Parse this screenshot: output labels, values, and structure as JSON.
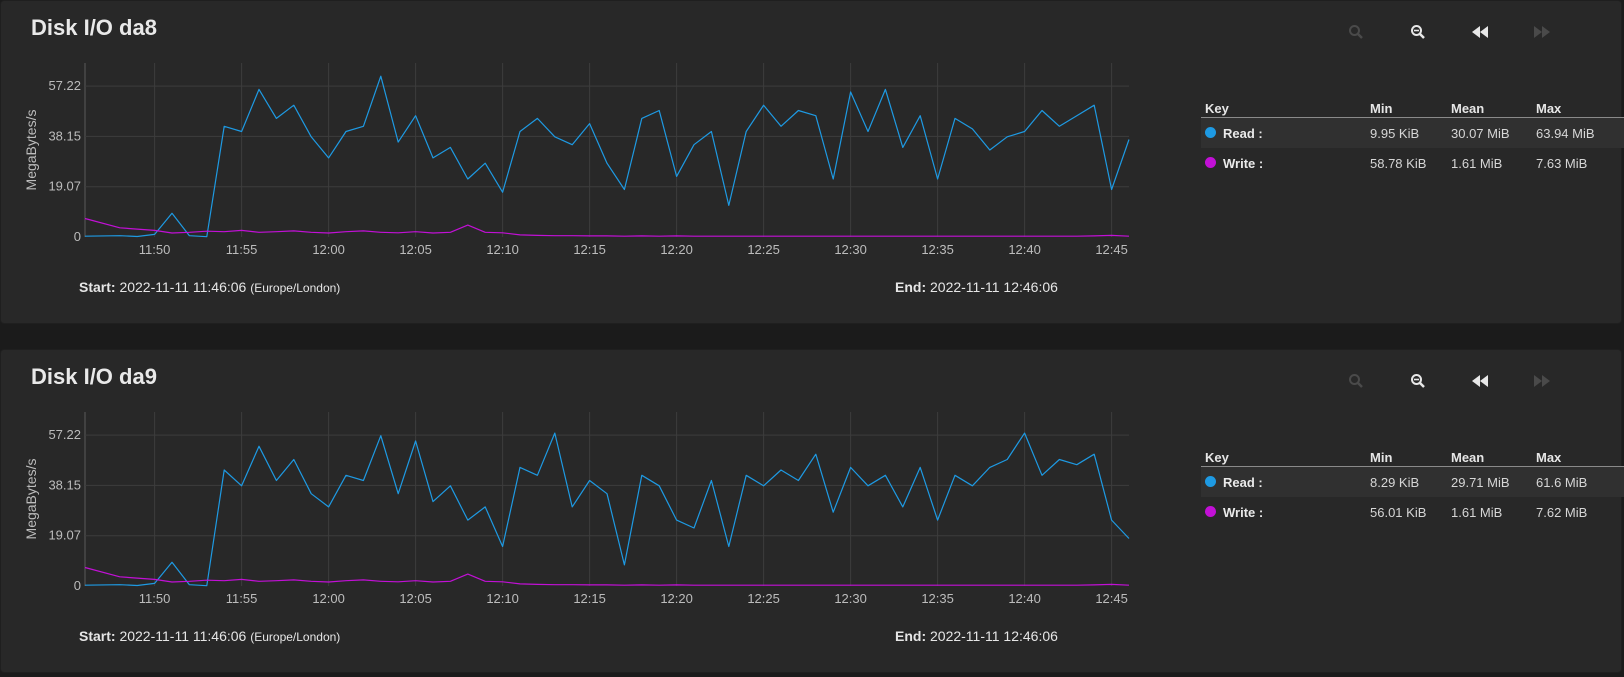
{
  "cards": [
    {
      "title": "Disk I/O da8",
      "start_label": "Start:",
      "start_value": "2022-11-11 11:46:06",
      "timezone": "(Europe/London)",
      "end_label": "End:",
      "end_value": "2022-11-11 12:46:06",
      "legend": {
        "header": {
          "key": "Key",
          "min": "Min",
          "mean": "Mean",
          "max": "Max"
        },
        "rows": [
          {
            "name": "Read :",
            "color": "#1e9ae3",
            "min": "9.95 KiB",
            "mean": "30.07 MiB",
            "max": "63.94 MiB"
          },
          {
            "name": "Write :",
            "color": "#c210d6",
            "min": "58.78 KiB",
            "mean": "1.61 MiB",
            "max": "7.63 MiB"
          }
        ]
      },
      "toolbar": {
        "zoom_in": "zoom-in-icon",
        "zoom_out": "zoom-out-icon",
        "back": "rewind-icon",
        "forward": "fast-forward-icon"
      }
    },
    {
      "title": "Disk I/O da9",
      "start_label": "Start:",
      "start_value": "2022-11-11 11:46:06",
      "timezone": "(Europe/London)",
      "end_label": "End:",
      "end_value": "2022-11-11 12:46:06",
      "legend": {
        "header": {
          "key": "Key",
          "min": "Min",
          "mean": "Mean",
          "max": "Max"
        },
        "rows": [
          {
            "name": "Read :",
            "color": "#1e9ae3",
            "min": "8.29 KiB",
            "mean": "29.71 MiB",
            "max": "61.6 MiB"
          },
          {
            "name": "Write :",
            "color": "#c210d6",
            "min": "56.01 KiB",
            "mean": "1.61 MiB",
            "max": "7.62 MiB"
          }
        ]
      },
      "toolbar": {
        "zoom_in": "zoom-in-icon",
        "zoom_out": "zoom-out-icon",
        "back": "rewind-icon",
        "forward": "fast-forward-icon"
      }
    }
  ],
  "chart_data": [
    {
      "type": "line",
      "ylabel": "MegaBytes/s",
      "yticks": [
        0,
        19.07,
        38.15,
        57.22
      ],
      "ylim": [
        0,
        66
      ],
      "xlim": [
        "11:46",
        "12:46"
      ],
      "xticks": [
        "11:50",
        "11:55",
        "12:00",
        "12:05",
        "12:10",
        "12:15",
        "12:20",
        "12:25",
        "12:30",
        "12:35",
        "12:40",
        "12:45"
      ],
      "grid": true,
      "series": [
        {
          "name": "Read",
          "color": "#1e9ae3",
          "x": [
            "11:46",
            "11:48",
            "11:49",
            "11:50",
            "11:51",
            "11:52",
            "11:53",
            "11:54",
            "11:55",
            "11:56",
            "11:57",
            "11:58",
            "11:59",
            "12:00",
            "12:01",
            "12:02",
            "12:03",
            "12:04",
            "12:05",
            "12:06",
            "12:07",
            "12:08",
            "12:09",
            "12:10",
            "12:11",
            "12:12",
            "12:13",
            "12:14",
            "12:15",
            "12:16",
            "12:17",
            "12:18",
            "12:19",
            "12:20",
            "12:21",
            "12:22",
            "12:23",
            "12:24",
            "12:25",
            "12:26",
            "12:27",
            "12:28",
            "12:29",
            "12:30",
            "12:31",
            "12:32",
            "12:33",
            "12:34",
            "12:35",
            "12:36",
            "12:37",
            "12:38",
            "12:39",
            "12:40",
            "12:41",
            "12:42",
            "12:43",
            "12:44",
            "12:45",
            "12:46"
          ],
          "y": [
            0.3,
            0.5,
            0.2,
            1,
            9,
            0.5,
            0.1,
            42,
            40,
            56,
            45,
            50,
            38,
            30,
            40,
            42,
            61,
            36,
            46,
            30,
            34,
            22,
            28,
            17,
            40,
            45,
            38,
            35,
            43,
            28,
            18,
            45,
            48,
            23,
            35,
            40,
            12,
            40,
            50,
            42,
            48,
            46,
            22,
            55,
            40,
            56,
            34,
            46,
            22,
            45,
            41,
            33,
            38,
            40,
            48,
            42,
            46,
            50,
            18,
            37
          ]
        },
        {
          "name": "Write",
          "color": "#c210d6",
          "x": [
            "11:46",
            "11:48",
            "11:49",
            "11:50",
            "11:51",
            "11:52",
            "11:53",
            "11:54",
            "11:55",
            "11:56",
            "11:57",
            "11:58",
            "11:59",
            "12:00",
            "12:01",
            "12:02",
            "12:03",
            "12:04",
            "12:05",
            "12:06",
            "12:07",
            "12:08",
            "12:09",
            "12:10",
            "12:11",
            "12:12",
            "12:13",
            "12:14",
            "12:15",
            "12:16",
            "12:17",
            "12:18",
            "12:19",
            "12:20",
            "12:21",
            "12:22",
            "12:23",
            "12:24",
            "12:25",
            "12:26",
            "12:27",
            "12:28",
            "12:29",
            "12:30",
            "12:31",
            "12:32",
            "12:33",
            "12:34",
            "12:35",
            "12:36",
            "12:37",
            "12:38",
            "12:39",
            "12:40",
            "12:41",
            "12:42",
            "12:43",
            "12:44",
            "12:45",
            "12:46"
          ],
          "y": [
            7,
            3.5,
            3,
            2.5,
            1.5,
            1.8,
            2.2,
            2,
            2.5,
            1.8,
            2,
            2.3,
            1.8,
            1.5,
            2,
            2.3,
            1.8,
            1.6,
            2,
            1.5,
            1.8,
            4.5,
            1.8,
            1.6,
            0.8,
            0.6,
            0.5,
            0.5,
            0.4,
            0.4,
            0.3,
            0.4,
            0.3,
            0.4,
            0.3,
            0.3,
            0.3,
            0.3,
            0.3,
            0.3,
            0.3,
            0.3,
            0.3,
            0.3,
            0.3,
            0.3,
            0.3,
            0.3,
            0.3,
            0.3,
            0.3,
            0.3,
            0.3,
            0.3,
            0.3,
            0.3,
            0.3,
            0.4,
            0.6,
            0.3
          ]
        }
      ]
    },
    {
      "type": "line",
      "ylabel": "MegaBytes/s",
      "yticks": [
        0,
        19.07,
        38.15,
        57.22
      ],
      "ylim": [
        0,
        66
      ],
      "xlim": [
        "11:46",
        "12:46"
      ],
      "xticks": [
        "11:50",
        "11:55",
        "12:00",
        "12:05",
        "12:10",
        "12:15",
        "12:20",
        "12:25",
        "12:30",
        "12:35",
        "12:40",
        "12:45"
      ],
      "grid": true,
      "series": [
        {
          "name": "Read",
          "color": "#1e9ae3",
          "x": [
            "11:46",
            "11:48",
            "11:49",
            "11:50",
            "11:51",
            "11:52",
            "11:53",
            "11:54",
            "11:55",
            "11:56",
            "11:57",
            "11:58",
            "11:59",
            "12:00",
            "12:01",
            "12:02",
            "12:03",
            "12:04",
            "12:05",
            "12:06",
            "12:07",
            "12:08",
            "12:09",
            "12:10",
            "12:11",
            "12:12",
            "12:13",
            "12:14",
            "12:15",
            "12:16",
            "12:17",
            "12:18",
            "12:19",
            "12:20",
            "12:21",
            "12:22",
            "12:23",
            "12:24",
            "12:25",
            "12:26",
            "12:27",
            "12:28",
            "12:29",
            "12:30",
            "12:31",
            "12:32",
            "12:33",
            "12:34",
            "12:35",
            "12:36",
            "12:37",
            "12:38",
            "12:39",
            "12:40",
            "12:41",
            "12:42",
            "12:43",
            "12:44",
            "12:45",
            "12:46"
          ],
          "y": [
            0.3,
            0.5,
            0.2,
            1,
            9,
            0.5,
            0.1,
            44,
            38,
            53,
            40,
            48,
            35,
            30,
            42,
            40,
            57,
            35,
            55,
            32,
            38,
            25,
            30,
            15,
            45,
            42,
            58,
            30,
            40,
            35,
            8,
            42,
            38,
            25,
            22,
            40,
            15,
            42,
            38,
            44,
            40,
            50,
            28,
            45,
            38,
            42,
            30,
            45,
            25,
            42,
            38,
            45,
            48,
            58,
            42,
            48,
            46,
            50,
            25,
            18
          ]
        },
        {
          "name": "Write",
          "color": "#c210d6",
          "x": [
            "11:46",
            "11:48",
            "11:49",
            "11:50",
            "11:51",
            "11:52",
            "11:53",
            "11:54",
            "11:55",
            "11:56",
            "11:57",
            "11:58",
            "11:59",
            "12:00",
            "12:01",
            "12:02",
            "12:03",
            "12:04",
            "12:05",
            "12:06",
            "12:07",
            "12:08",
            "12:09",
            "12:10",
            "12:11",
            "12:12",
            "12:13",
            "12:14",
            "12:15",
            "12:16",
            "12:17",
            "12:18",
            "12:19",
            "12:20",
            "12:21",
            "12:22",
            "12:23",
            "12:24",
            "12:25",
            "12:26",
            "12:27",
            "12:28",
            "12:29",
            "12:30",
            "12:31",
            "12:32",
            "12:33",
            "12:34",
            "12:35",
            "12:36",
            "12:37",
            "12:38",
            "12:39",
            "12:40",
            "12:41",
            "12:42",
            "12:43",
            "12:44",
            "12:45",
            "12:46"
          ],
          "y": [
            7,
            3.5,
            3,
            2.5,
            1.5,
            1.8,
            2.2,
            2,
            2.5,
            1.8,
            2,
            2.3,
            1.8,
            1.5,
            2,
            2.3,
            1.8,
            1.6,
            2,
            1.5,
            1.8,
            4.5,
            1.8,
            1.6,
            0.8,
            0.6,
            0.5,
            0.5,
            0.4,
            0.4,
            0.3,
            0.4,
            0.3,
            0.4,
            0.3,
            0.3,
            0.3,
            0.3,
            0.3,
            0.3,
            0.3,
            0.3,
            0.3,
            0.3,
            0.3,
            0.3,
            0.3,
            0.3,
            0.3,
            0.3,
            0.3,
            0.3,
            0.3,
            0.3,
            0.3,
            0.3,
            0.3,
            0.4,
            0.6,
            0.3
          ]
        }
      ]
    }
  ]
}
